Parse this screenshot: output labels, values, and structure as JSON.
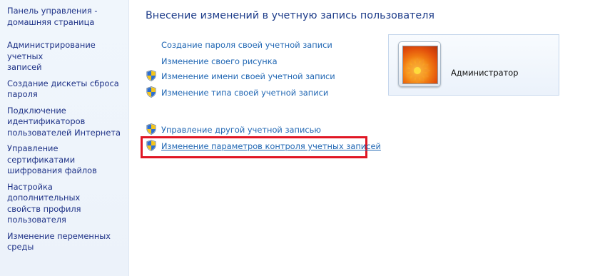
{
  "sidebar": {
    "home": "Панель управления -\nдомашняя страница",
    "items": [
      "Администрирование учетных\nзаписей",
      "Создание дискеты сброса\nпароля",
      "Подключение\nидентификаторов\nпользователей Интернета",
      "Управление сертификатами\nшифрования файлов",
      "Настройка дополнительных\nсвойств профиля\nпользователя",
      "Изменение переменных\nсреды"
    ]
  },
  "main": {
    "title": "Внесение изменений в учетную запись пользователя",
    "tasks": [
      {
        "label": "Создание пароля своей учетной записи",
        "icon": null
      },
      {
        "label": "Изменение своего рисунка",
        "icon": null
      },
      {
        "label": "Изменение имени своей учетной записи",
        "icon": "uac-shield-icon"
      },
      {
        "label": "Изменение типа своей учетной записи",
        "icon": "uac-shield-icon"
      }
    ],
    "other_tasks": [
      {
        "label": "Управление другой учетной записью",
        "icon": "uac-shield-icon"
      },
      {
        "label": "Изменение параметров контроля учетных записей",
        "icon": "uac-shield-icon",
        "highlighted": true
      }
    ]
  },
  "user": {
    "name": "Администратор",
    "picture": "flower-picture"
  },
  "colors": {
    "link": "#1f66b3",
    "sidebar_link": "#1e3287",
    "title": "#1e3d8a",
    "highlight_border": "#e01624"
  }
}
